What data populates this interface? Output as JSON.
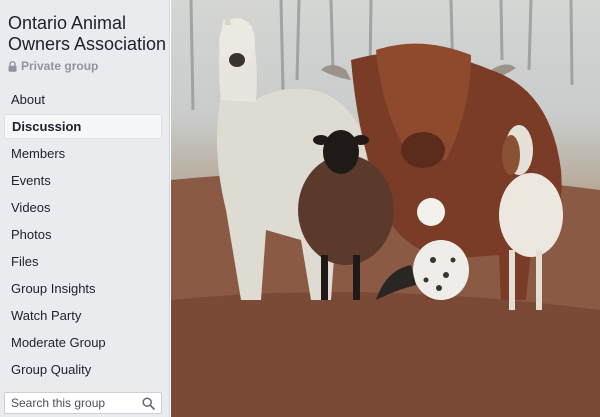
{
  "group": {
    "name": "Ontario Animal Owners Association",
    "privacy": "Private group"
  },
  "nav": {
    "items": [
      {
        "label": "About"
      },
      {
        "label": "Discussion"
      },
      {
        "label": "Members"
      },
      {
        "label": "Events"
      },
      {
        "label": "Videos"
      },
      {
        "label": "Photos"
      },
      {
        "label": "Files"
      },
      {
        "label": "Group Insights"
      },
      {
        "label": "Watch Party"
      },
      {
        "label": "Moderate Group"
      },
      {
        "label": "Group Quality"
      }
    ],
    "active": "Discussion"
  },
  "search": {
    "placeholder": "Search this group"
  },
  "cover": {
    "subject": "cover-photo-animals"
  },
  "colors": {
    "sidebar_bg": "#e9ebee",
    "text": "#1d2129",
    "muted": "#90949c"
  }
}
